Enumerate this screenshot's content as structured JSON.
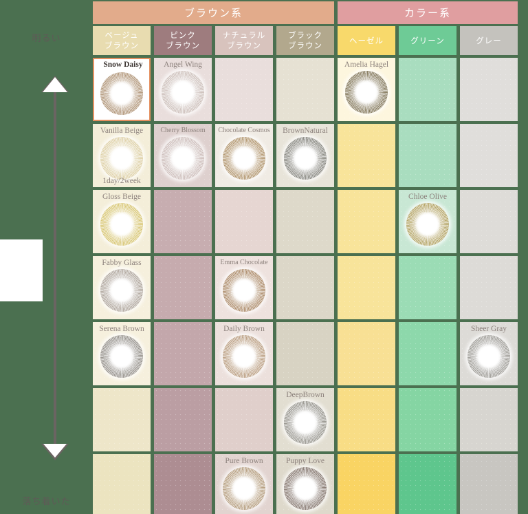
{
  "page": {
    "background_color": "#4b7050",
    "axis": {
      "top_label": "明るい",
      "bottom_label": "落ち着いた",
      "line_color": "#6b6462"
    }
  },
  "groups": [
    {
      "label": "ブラウン系",
      "color": "#e2ab8b",
      "span": 4
    },
    {
      "label": "カラー系",
      "color": "#e09ea0",
      "span": 3
    }
  ],
  "categories": [
    {
      "line1": "ベージュ",
      "line2": "ブラウン",
      "color": "#e8dcb0",
      "cell_color": "#f2ecd7"
    },
    {
      "line1": "ピンク",
      "line2": "ブラウン",
      "color": "#9e7c7e",
      "cell_color": "#cbb0b3"
    },
    {
      "line1": "ナチュラル",
      "line2": "ブラウン",
      "color": "#d8c3bd",
      "cell_color": "#e6d8d3"
    },
    {
      "line1": "ブラック",
      "line2": "ブラウン",
      "color": "#b2a88d",
      "cell_color": "#dcd7c7"
    },
    {
      "line1": "ヘーゼル",
      "line2": "",
      "color": "#f8d96b",
      "cell_color": "#f8e49a"
    },
    {
      "line1": "グリーン",
      "line2": "",
      "color": "#6ecb96",
      "cell_color": "#95dcb1"
    },
    {
      "line1": "グレー",
      "line2": "",
      "color": "#c4c2bd",
      "cell_color": "#d2d0cb"
    }
  ],
  "rows": [
    [
      {
        "name": "Snow Daisy",
        "lens": true,
        "selected": true,
        "bg": "#ffffff",
        "ring": "#b49a7e"
      },
      {
        "name": "Angel Wing",
        "lens": true,
        "bg": "#e9dedc",
        "ring": "#cfc2bd"
      },
      {
        "name": "",
        "lens": false,
        "bg": "#e9dedc"
      },
      {
        "name": "",
        "lens": false,
        "bg": "#e6e1d3"
      },
      {
        "name": "Amelia Hagel",
        "lens": true,
        "bg": "#fdf6de",
        "ring": "#8a7f63"
      },
      {
        "name": "",
        "lens": false,
        "bg": "#a9ddbf"
      },
      {
        "name": "",
        "lens": false,
        "bg": "#e0dedb"
      }
    ],
    [
      {
        "name": "Vanilla Beige",
        "sub": "1day/2week",
        "lens": true,
        "bg": "#f4eed9",
        "ring": "#dfd2a9"
      },
      {
        "name": "Cherry Blossom",
        "lens": true,
        "bg": "#ded0ce",
        "ring": "#cfc0bd",
        "small": true
      },
      {
        "name": "Chocolate Cosmos",
        "lens": true,
        "bg": "#f0ebe4",
        "ring": "#b59a74",
        "small": true
      },
      {
        "name": "BrownNatural",
        "lens": true,
        "bg": "#e8e4d9",
        "ring": "#8e8d86"
      },
      {
        "name": "",
        "lens": false,
        "bg": "#f8e49a"
      },
      {
        "name": "",
        "lens": false,
        "bg": "#a9ddbf"
      },
      {
        "name": "",
        "lens": false,
        "bg": "#e0dedb"
      }
    ],
    [
      {
        "name": "Gloss Beige",
        "lens": true,
        "bg": "#f4eed9",
        "ring": "#d9c878"
      },
      {
        "name": "",
        "lens": false,
        "bg": "#c7adb0"
      },
      {
        "name": "",
        "lens": false,
        "bg": "#e6d6d2"
      },
      {
        "name": "",
        "lens": false,
        "bg": "#ded9ca"
      },
      {
        "name": "",
        "lens": false,
        "bg": "#f8e49a"
      },
      {
        "name": "Chloe Olive",
        "lens": true,
        "bg": "#c8e7d4",
        "ring": "#b6a76a"
      },
      {
        "name": "",
        "lens": false,
        "bg": "#dedcd8"
      }
    ],
    [
      {
        "name": "Fabby Glass",
        "lens": true,
        "bg": "#f6f0dd",
        "ring": "#b3aaa1"
      },
      {
        "name": "",
        "lens": false,
        "bg": "#c6abae"
      },
      {
        "name": "Emma Chocolate",
        "lens": true,
        "bg": "#eee2de",
        "ring": "#b09070",
        "small": true
      },
      {
        "name": "",
        "lens": false,
        "bg": "#dcd7c8"
      },
      {
        "name": "",
        "lens": false,
        "bg": "#f8e49a"
      },
      {
        "name": "",
        "lens": false,
        "bg": "#9bdcb5"
      },
      {
        "name": "",
        "lens": false,
        "bg": "#dddbd7"
      }
    ],
    [
      {
        "name": "Serena Brown",
        "lens": true,
        "bg": "#f6f0dd",
        "ring": "#9a9690"
      },
      {
        "name": "",
        "lens": false,
        "bg": "#c3a7ab"
      },
      {
        "name": "Daily Brown",
        "lens": true,
        "bg": "#ece0dc",
        "ring": "#bda286"
      },
      {
        "name": "",
        "lens": false,
        "bg": "#d8d3c3"
      },
      {
        "name": "",
        "lens": false,
        "bg": "#f8e094"
      },
      {
        "name": "",
        "lens": false,
        "bg": "#8dd8ab"
      },
      {
        "name": "Sheer Gray",
        "lens": true,
        "bg": "#dddbd7",
        "ring": "#a3a19c"
      }
    ],
    [
      {
        "name": "",
        "lens": false,
        "bg": "#eee6c9"
      },
      {
        "name": "",
        "lens": false,
        "bg": "#bb9ea3"
      },
      {
        "name": "",
        "lens": false,
        "bg": "#e0cfcb"
      },
      {
        "name": "DeepBrown",
        "lens": true,
        "bg": "#e2ded1",
        "ring": "#9c9a93"
      },
      {
        "name": "",
        "lens": false,
        "bg": "#f8dd85"
      },
      {
        "name": "",
        "lens": false,
        "bg": "#85d5a3"
      },
      {
        "name": "",
        "lens": false,
        "bg": "#d7d5d0"
      }
    ],
    [
      {
        "name": "",
        "lens": false,
        "bg": "#ece4c0"
      },
      {
        "name": "",
        "lens": false,
        "bg": "#ad8d92"
      },
      {
        "name": "Pure Brown",
        "lens": true,
        "bg": "#e2d4d0",
        "ring": "#b8a183"
      },
      {
        "name": "Puppy Love",
        "lens": true,
        "bg": "#ded9cb",
        "ring": "#8c7f77"
      },
      {
        "name": "",
        "lens": false,
        "bg": "#f9d463"
      },
      {
        "name": "",
        "lens": false,
        "bg": "#5ec68d"
      },
      {
        "name": "",
        "lens": false,
        "bg": "#c8c6c1"
      }
    ]
  ]
}
